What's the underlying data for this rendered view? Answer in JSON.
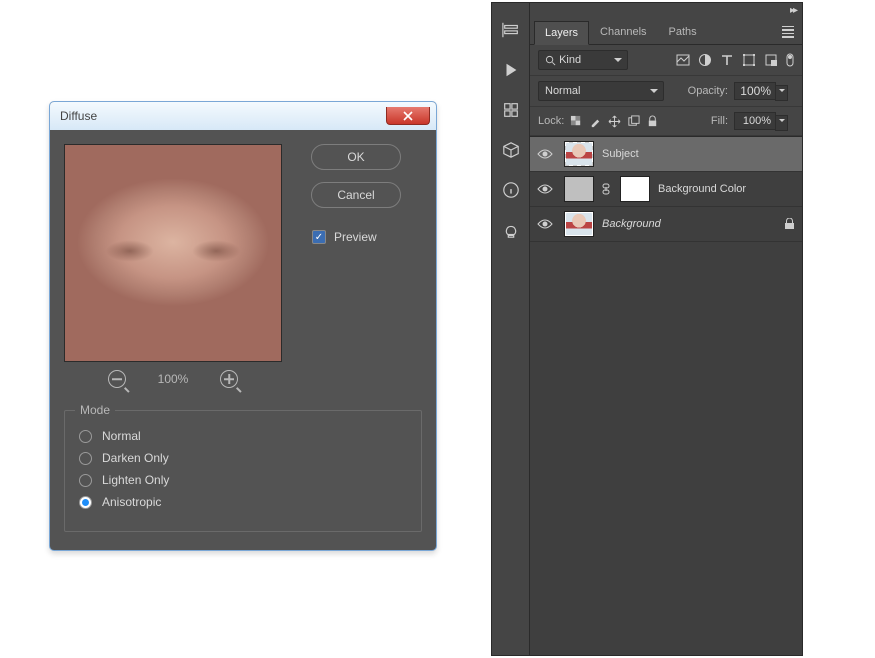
{
  "dialog": {
    "title": "Diffuse",
    "ok": "OK",
    "cancel": "Cancel",
    "preview_label": "Preview",
    "preview_checked": true,
    "zoom": "100%",
    "mode_legend": "Mode",
    "modes": [
      "Normal",
      "Darken Only",
      "Lighten Only",
      "Anisotropic"
    ],
    "mode_selected": 3
  },
  "panel": {
    "tabs": [
      "Layers",
      "Channels",
      "Paths"
    ],
    "tab_active": 0,
    "filter_kind": "Kind",
    "blend_mode": "Normal",
    "opacity_label": "Opacity:",
    "opacity_value": "100%",
    "lock_label": "Lock:",
    "fill_label": "Fill:",
    "fill_value": "100%",
    "layers": [
      {
        "name": "Subject",
        "visible": true,
        "selected": true,
        "thumb": "portrait",
        "locked": false,
        "italic": false
      },
      {
        "name": "Background Color",
        "visible": true,
        "selected": false,
        "thumb": "fill-mask",
        "locked": false,
        "italic": false
      },
      {
        "name": "Background",
        "visible": true,
        "selected": false,
        "thumb": "portrait-white",
        "locked": true,
        "italic": true
      }
    ]
  }
}
